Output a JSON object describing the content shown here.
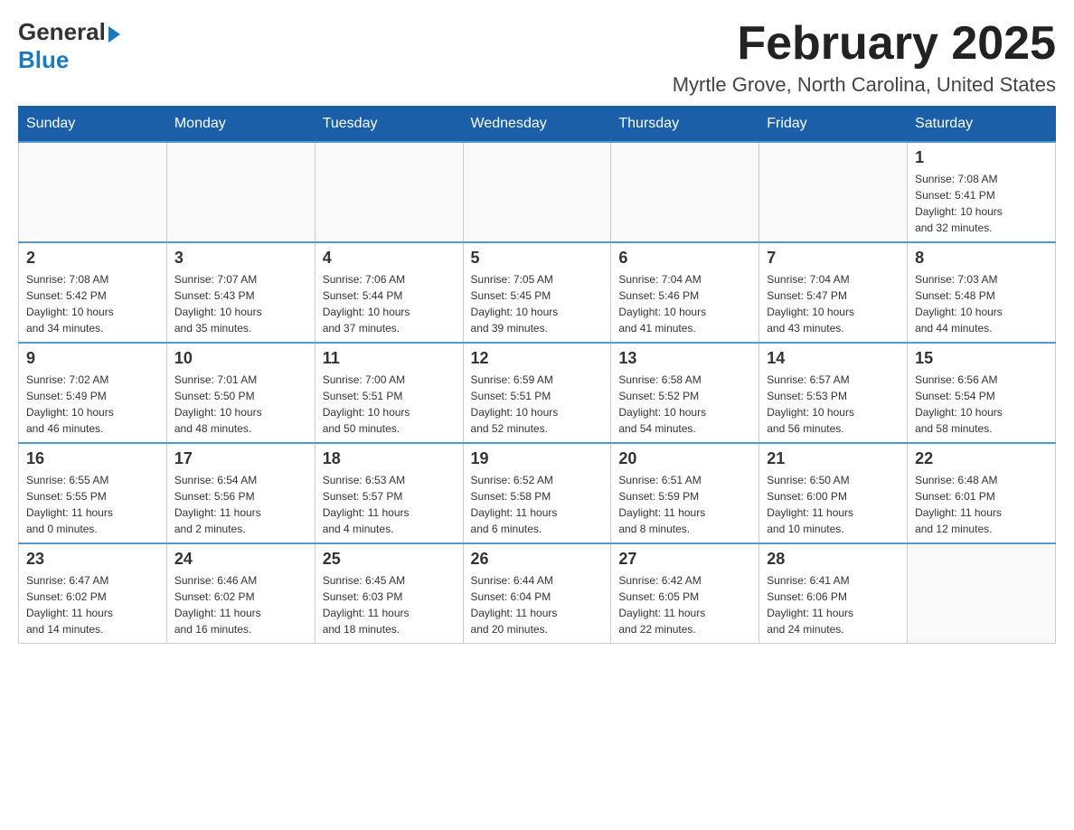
{
  "header": {
    "logo_line1": "General",
    "logo_line2": "Blue",
    "title": "February 2025",
    "subtitle": "Myrtle Grove, North Carolina, United States"
  },
  "days_of_week": [
    "Sunday",
    "Monday",
    "Tuesday",
    "Wednesday",
    "Thursday",
    "Friday",
    "Saturday"
  ],
  "weeks": [
    {
      "cells": [
        {
          "day": "",
          "info": ""
        },
        {
          "day": "",
          "info": ""
        },
        {
          "day": "",
          "info": ""
        },
        {
          "day": "",
          "info": ""
        },
        {
          "day": "",
          "info": ""
        },
        {
          "day": "",
          "info": ""
        },
        {
          "day": "1",
          "info": "Sunrise: 7:08 AM\nSunset: 5:41 PM\nDaylight: 10 hours\nand 32 minutes."
        }
      ]
    },
    {
      "cells": [
        {
          "day": "2",
          "info": "Sunrise: 7:08 AM\nSunset: 5:42 PM\nDaylight: 10 hours\nand 34 minutes."
        },
        {
          "day": "3",
          "info": "Sunrise: 7:07 AM\nSunset: 5:43 PM\nDaylight: 10 hours\nand 35 minutes."
        },
        {
          "day": "4",
          "info": "Sunrise: 7:06 AM\nSunset: 5:44 PM\nDaylight: 10 hours\nand 37 minutes."
        },
        {
          "day": "5",
          "info": "Sunrise: 7:05 AM\nSunset: 5:45 PM\nDaylight: 10 hours\nand 39 minutes."
        },
        {
          "day": "6",
          "info": "Sunrise: 7:04 AM\nSunset: 5:46 PM\nDaylight: 10 hours\nand 41 minutes."
        },
        {
          "day": "7",
          "info": "Sunrise: 7:04 AM\nSunset: 5:47 PM\nDaylight: 10 hours\nand 43 minutes."
        },
        {
          "day": "8",
          "info": "Sunrise: 7:03 AM\nSunset: 5:48 PM\nDaylight: 10 hours\nand 44 minutes."
        }
      ]
    },
    {
      "cells": [
        {
          "day": "9",
          "info": "Sunrise: 7:02 AM\nSunset: 5:49 PM\nDaylight: 10 hours\nand 46 minutes."
        },
        {
          "day": "10",
          "info": "Sunrise: 7:01 AM\nSunset: 5:50 PM\nDaylight: 10 hours\nand 48 minutes."
        },
        {
          "day": "11",
          "info": "Sunrise: 7:00 AM\nSunset: 5:51 PM\nDaylight: 10 hours\nand 50 minutes."
        },
        {
          "day": "12",
          "info": "Sunrise: 6:59 AM\nSunset: 5:51 PM\nDaylight: 10 hours\nand 52 minutes."
        },
        {
          "day": "13",
          "info": "Sunrise: 6:58 AM\nSunset: 5:52 PM\nDaylight: 10 hours\nand 54 minutes."
        },
        {
          "day": "14",
          "info": "Sunrise: 6:57 AM\nSunset: 5:53 PM\nDaylight: 10 hours\nand 56 minutes."
        },
        {
          "day": "15",
          "info": "Sunrise: 6:56 AM\nSunset: 5:54 PM\nDaylight: 10 hours\nand 58 minutes."
        }
      ]
    },
    {
      "cells": [
        {
          "day": "16",
          "info": "Sunrise: 6:55 AM\nSunset: 5:55 PM\nDaylight: 11 hours\nand 0 minutes."
        },
        {
          "day": "17",
          "info": "Sunrise: 6:54 AM\nSunset: 5:56 PM\nDaylight: 11 hours\nand 2 minutes."
        },
        {
          "day": "18",
          "info": "Sunrise: 6:53 AM\nSunset: 5:57 PM\nDaylight: 11 hours\nand 4 minutes."
        },
        {
          "day": "19",
          "info": "Sunrise: 6:52 AM\nSunset: 5:58 PM\nDaylight: 11 hours\nand 6 minutes."
        },
        {
          "day": "20",
          "info": "Sunrise: 6:51 AM\nSunset: 5:59 PM\nDaylight: 11 hours\nand 8 minutes."
        },
        {
          "day": "21",
          "info": "Sunrise: 6:50 AM\nSunset: 6:00 PM\nDaylight: 11 hours\nand 10 minutes."
        },
        {
          "day": "22",
          "info": "Sunrise: 6:48 AM\nSunset: 6:01 PM\nDaylight: 11 hours\nand 12 minutes."
        }
      ]
    },
    {
      "cells": [
        {
          "day": "23",
          "info": "Sunrise: 6:47 AM\nSunset: 6:02 PM\nDaylight: 11 hours\nand 14 minutes."
        },
        {
          "day": "24",
          "info": "Sunrise: 6:46 AM\nSunset: 6:02 PM\nDaylight: 11 hours\nand 16 minutes."
        },
        {
          "day": "25",
          "info": "Sunrise: 6:45 AM\nSunset: 6:03 PM\nDaylight: 11 hours\nand 18 minutes."
        },
        {
          "day": "26",
          "info": "Sunrise: 6:44 AM\nSunset: 6:04 PM\nDaylight: 11 hours\nand 20 minutes."
        },
        {
          "day": "27",
          "info": "Sunrise: 6:42 AM\nSunset: 6:05 PM\nDaylight: 11 hours\nand 22 minutes."
        },
        {
          "day": "28",
          "info": "Sunrise: 6:41 AM\nSunset: 6:06 PM\nDaylight: 11 hours\nand 24 minutes."
        },
        {
          "day": "",
          "info": ""
        }
      ]
    }
  ]
}
